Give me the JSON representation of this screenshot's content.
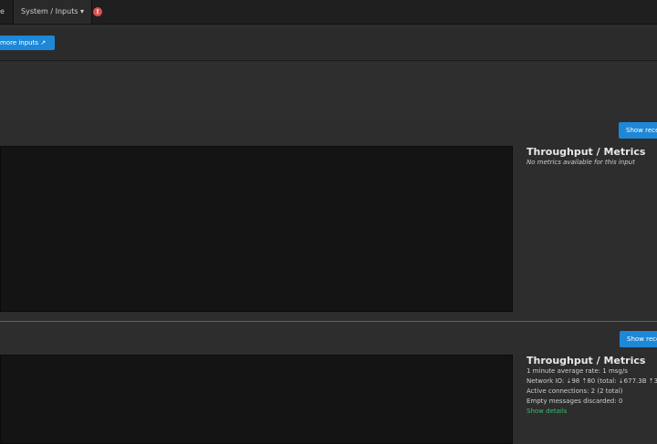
{
  "nav": {
    "left_fragment": "e",
    "system_menu": "System / Inputs ▾",
    "notification_count": "!"
  },
  "toolbar": {
    "more_inputs_label": "more inputs ↗"
  },
  "inputs": [
    {
      "show_button": "Show rece",
      "metrics_title": "Throughput / Metrics",
      "metrics_lines": [
        "No metrics available for this input"
      ],
      "show_details": ""
    },
    {
      "show_button": "Show rece",
      "metrics_title": "Throughput / Metrics",
      "metrics_lines": [
        "1 minute average rate: 1 msg/s",
        "Network IO: ⇣98 ⇡80 (total: ⇣677.3B ⇡3",
        "Active connections: 2 (2 total)",
        "Empty messages discarded: 0"
      ],
      "show_details": "Show details"
    }
  ]
}
